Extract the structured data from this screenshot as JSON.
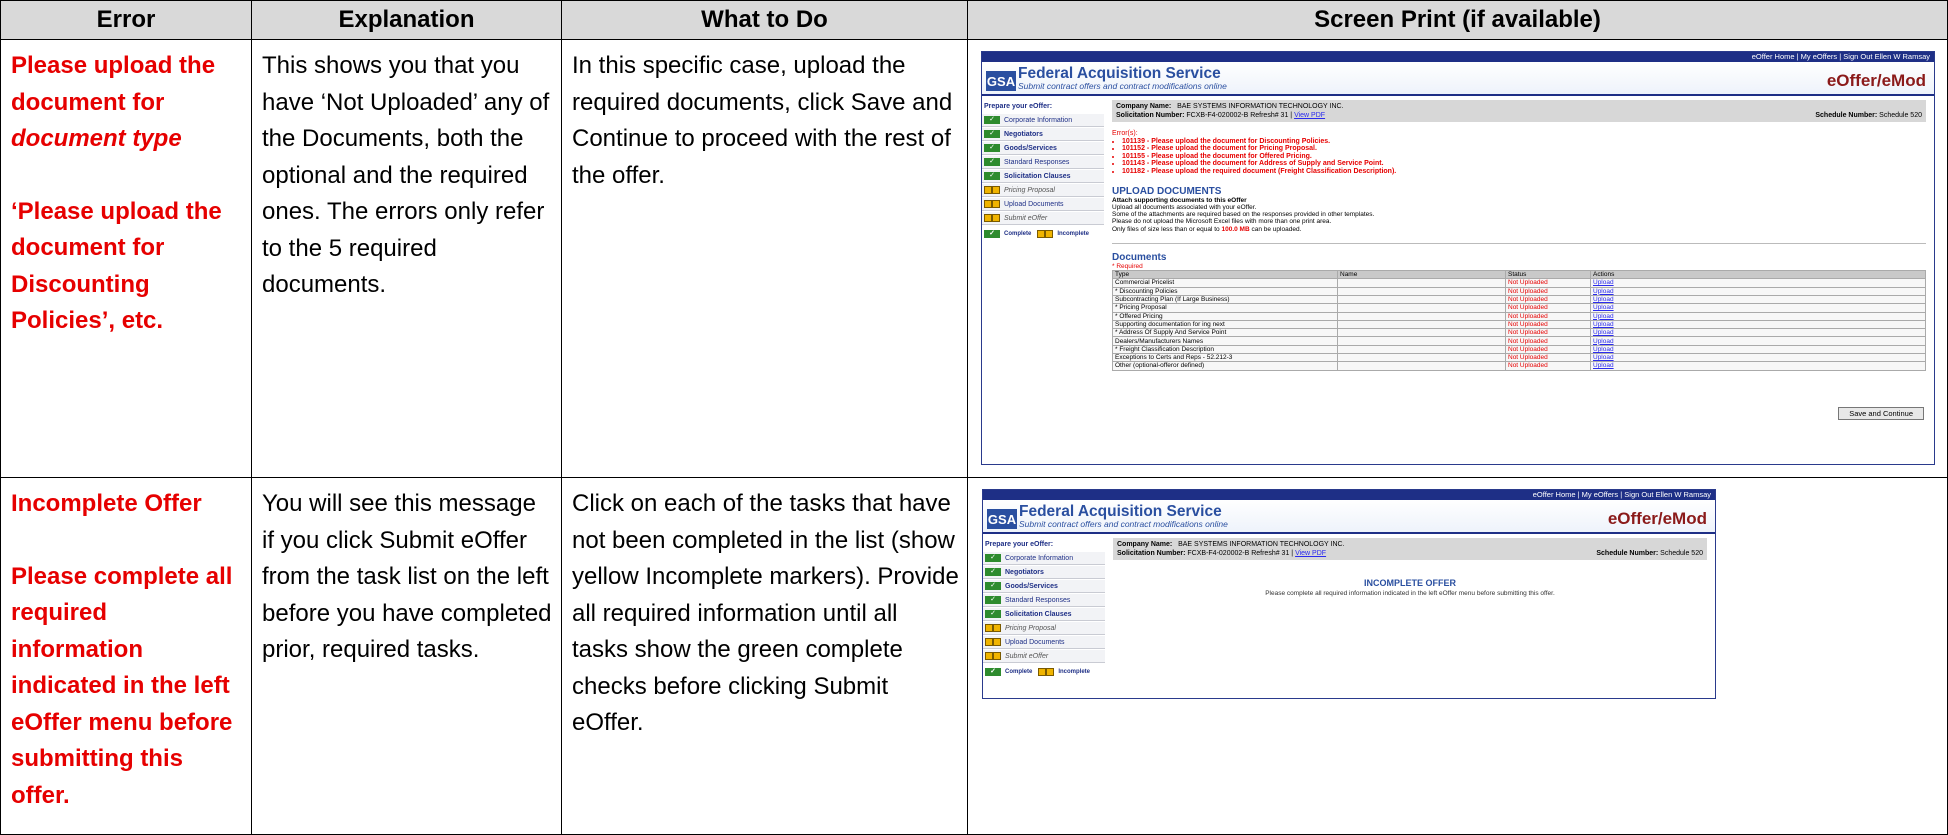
{
  "headers": {
    "error": "Error",
    "explanation": "Explanation",
    "what_to_do": "What to Do",
    "screen_print": "Screen Print (if available)"
  },
  "rows": [
    {
      "error_line1": "Please upload the document for",
      "error_italic": "document type",
      "error_line2": "‘Please upload the document for Discounting Policies’, etc.",
      "explanation": "This shows you that you have ‘Not Uploaded’ any of the Documents, both the optional and the required ones.  The errors only refer to the 5 required documents.",
      "what_to_do": "In this specific case, upload the required documents, click Save and Continue to proceed with the rest of the offer."
    },
    {
      "error_line1": "Incomplete Offer",
      "error_line2": "Please complete all required information indicated in the left eOffer menu before submitting this offer.",
      "explanation": "You will see this message if you click Submit eOffer from the task list on the left before you have completed prior, required tasks.",
      "what_to_do": "Click on each of the tasks that have not been completed in the list (show yellow Incomplete markers).  Provide all required information until all tasks show the green complete checks before clicking Submit eOffer."
    }
  ],
  "app": {
    "top_links": "eOffer Home | My eOffers | Sign Out Ellen W Ramsay",
    "gsa": "GSA",
    "title": "Federal Acquisition Service",
    "subtitle": "Submit contract offers and contract modifications online",
    "brand": "eOffer/eMod",
    "prepare": "Prepare your eOffer:",
    "tasks": [
      {
        "label": "Corporate Information",
        "complete": true
      },
      {
        "label": "Negotiators",
        "complete": true
      },
      {
        "label": "Goods/Services",
        "complete": true
      },
      {
        "label": "Standard Responses",
        "complete": true
      },
      {
        "label": "Solicitation Clauses",
        "complete": true
      },
      {
        "label": "Pricing Proposal",
        "complete": false
      },
      {
        "label": "Upload Documents",
        "complete": false
      },
      {
        "label": "Submit eOffer",
        "complete": false
      }
    ],
    "legend_complete": "Complete",
    "legend_incomplete": "Incomplete",
    "company_label": "Company Name:",
    "company_value": "BAE SYSTEMS INFORMATION TECHNOLOGY INC.",
    "solicitation_label": "Solicitation Number:",
    "solicitation_value": "FCXB-F4-020002-B Refresh# 31 |",
    "view_pdf": "View PDF",
    "schedule_label": "Schedule Number:",
    "schedule_value": "Schedule 520",
    "errors_title": "Error(s):",
    "errors": [
      "101139 - Please upload the document for Discounting Policies.",
      "101152 - Please upload the document for Pricing Proposal.",
      "101155 - Please upload the document for Offered Pricing.",
      "101143 - Please upload the document for Address of Supply and Service Point.",
      "101182 - Please upload the required document (Freight Classification Description)."
    ],
    "upload_title": "UPLOAD DOCUMENTS",
    "upload_sub": "Attach supporting documents to this eOffer",
    "upload_lines": [
      "Upload all documents associated with your eOffer.",
      "Some of the attachments are required based on the responses provided in other templates.",
      "Please do not upload the Microsoft Excel files with more than one print area."
    ],
    "size_prefix": "Only files of size less than or equal to",
    "size_value": "100.0 MB",
    "size_suffix": "can be uploaded.",
    "documents_title": "Documents",
    "required_note": "* Required",
    "doc_cols": [
      "Type",
      "Name",
      "Status",
      "Actions"
    ],
    "documents": [
      {
        "type": "Commercial Pricelist",
        "status": "Not Uploaded",
        "action": "Upload"
      },
      {
        "type": "* Discounting Policies",
        "status": "Not Uploaded",
        "action": "Upload"
      },
      {
        "type": "Subcontracting Plan (If Large Business)",
        "status": "Not Uploaded",
        "action": "Upload"
      },
      {
        "type": "* Pricing Proposal",
        "status": "Not Uploaded",
        "action": "Upload"
      },
      {
        "type": "* Offered Pricing",
        "status": "Not Uploaded",
        "action": "Upload"
      },
      {
        "type": "Supporting documentation for ing next",
        "status": "Not Uploaded",
        "action": "Upload"
      },
      {
        "type": "* Address Of Supply And Service Point",
        "status": "Not Uploaded",
        "action": "Upload"
      },
      {
        "type": "Dealers/Manufacturers Names",
        "status": "Not Uploaded",
        "action": "Upload"
      },
      {
        "type": "* Freight Classification Description",
        "status": "Not Uploaded",
        "action": "Upload"
      },
      {
        "type": "Exceptions to Certs and Reps - 52.212-3",
        "status": "Not Uploaded",
        "action": "Upload"
      },
      {
        "type": "Other (optional-offeror defined)",
        "status": "Not Uploaded",
        "action": "Upload"
      }
    ],
    "save_button": "Save and Continue",
    "incomplete_title": "INCOMPLETE OFFER",
    "incomplete_msg": "Please complete all required information indicated in the left eOffer menu before submitting this offer."
  }
}
